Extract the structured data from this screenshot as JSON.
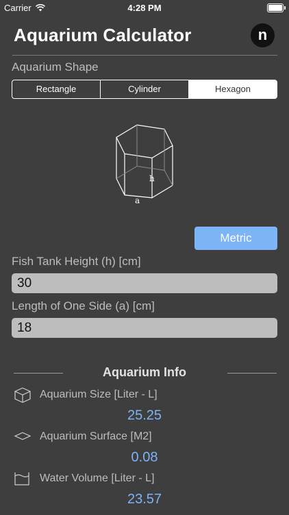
{
  "status": {
    "carrier": "Carrier",
    "time": "4:28 PM",
    "wifi_icon": "wifi-icon",
    "battery_icon": "battery-icon"
  },
  "app": {
    "title": "Aquarium Calculator",
    "logo_letter": "n"
  },
  "shape": {
    "label": "Aquarium Shape",
    "options": [
      "Rectangle",
      "Cylinder",
      "Hexagon"
    ],
    "selected": "Hexagon"
  },
  "diagram": {
    "h_label": "h",
    "a_label": "a"
  },
  "units_button": "Metric",
  "height": {
    "label": "Fish Tank Height (h) [cm]",
    "value": "30"
  },
  "side": {
    "label": "Length of One Side (a) [cm]",
    "value": "18"
  },
  "info": {
    "title": "Aquarium Info",
    "items": [
      {
        "label": "Aquarium Size [Liter - L]",
        "value": "25.25",
        "icon": "cube-icon"
      },
      {
        "label": "Aquarium Surface [M2]",
        "value": "0.08",
        "icon": "surface-icon"
      },
      {
        "label": "Water Volume [Liter - L]",
        "value": "23.57",
        "icon": "water-tank-icon"
      }
    ]
  }
}
